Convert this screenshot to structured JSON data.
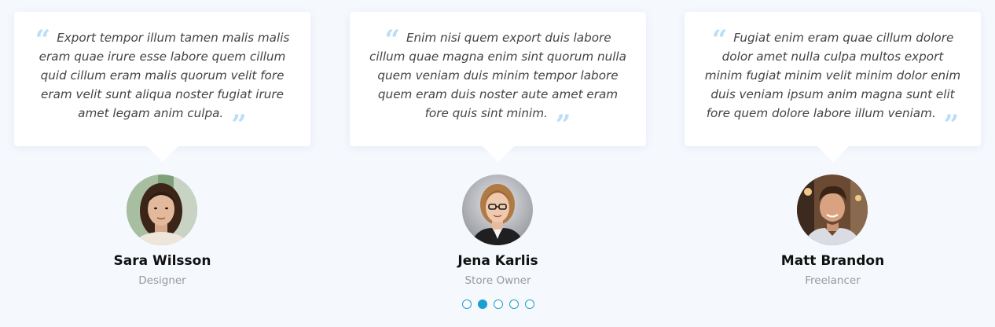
{
  "testimonials": [
    {
      "quote": "Export tempor illum tamen malis malis eram quae irure esse labore quem cillum quid cillum eram malis quorum velit fore eram velit sunt aliqua noster fugiat irure amet legam anim culpa.",
      "name": "Sara Wilsson",
      "role": "Designer"
    },
    {
      "quote": "Enim nisi quem export duis labore cillum quae magna enim sint quorum nulla quem veniam duis minim tempor labore quem eram duis noster aute amet eram fore quis sint minim.",
      "name": "Jena Karlis",
      "role": "Store Owner"
    },
    {
      "quote": "Fugiat enim eram quae cillum dolore dolor amet nulla culpa multos export minim fugiat minim velit minim dolor enim duis veniam ipsum anim magna sunt elit fore quem dolore labore illum veniam.",
      "name": "Matt Brandon",
      "role": "Freelancer"
    }
  ],
  "quote_icons": {
    "left": "“",
    "right": "”"
  },
  "pagination": {
    "count": 5,
    "active_index": 1
  },
  "colors": {
    "background": "#f5f8fd",
    "quote_icon": "#b9def5",
    "accent": "#1a9fcf"
  }
}
